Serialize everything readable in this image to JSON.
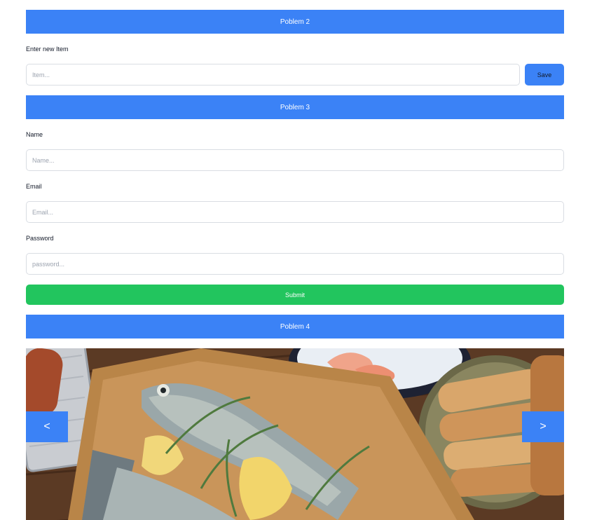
{
  "problem2": {
    "title": "Poblem 2",
    "item_label": "Enter new Item",
    "item_placeholder": "Item...",
    "save_label": "Save"
  },
  "problem3": {
    "title": "Poblem 3",
    "name_label": "Name",
    "name_placeholder": "Name...",
    "email_label": "Email",
    "email_placeholder": "Email...",
    "password_label": "Password",
    "password_placeholder": "password...",
    "submit_label": "Submit"
  },
  "problem4": {
    "title": "Poblem 4",
    "prev_label": "<",
    "next_label": ">",
    "slide_image": "grilled-trout-with-lemon-rosemary-and-bread-photo"
  },
  "colors": {
    "header_blue": "#3b82f6",
    "submit_green": "#22c55e",
    "input_border": "#d9dde3"
  }
}
